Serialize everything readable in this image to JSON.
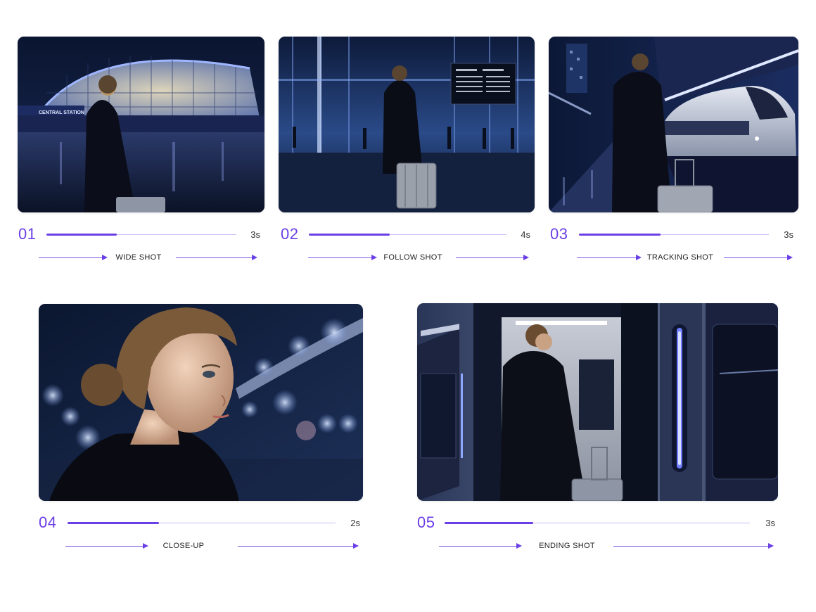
{
  "accent_color": "#6b3fe6",
  "shots": [
    {
      "number": "01",
      "duration": "3s",
      "progress": 0.37,
      "label": "WIDE SHOT",
      "sign_text": "CENTRAL STATION",
      "image_icon": "station-exterior-image"
    },
    {
      "number": "02",
      "duration": "4s",
      "progress": 0.41,
      "label": "FOLLOW SHOT",
      "image_icon": "station-concourse-image"
    },
    {
      "number": "03",
      "duration": "3s",
      "progress": 0.43,
      "label": "TRACKING SHOT",
      "image_icon": "platform-train-image"
    },
    {
      "number": "04",
      "duration": "2s",
      "progress": 0.34,
      "label": "CLOSE-UP",
      "image_icon": "woman-portrait-image"
    },
    {
      "number": "05",
      "duration": "3s",
      "progress": 0.29,
      "label": "ENDING SHOT",
      "image_icon": "train-door-image"
    }
  ]
}
